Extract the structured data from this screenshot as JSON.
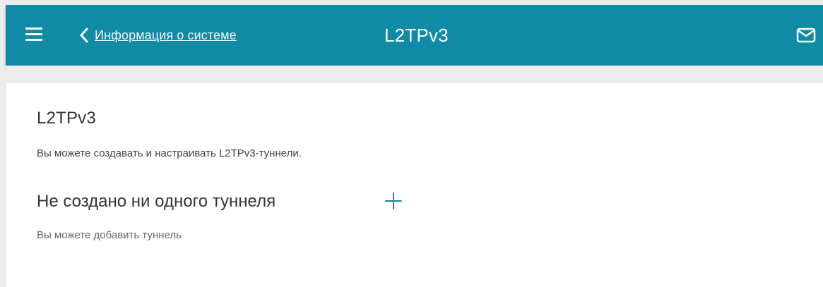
{
  "header": {
    "back_label": "Информация о системе",
    "title": "L2TPv3",
    "menu_icon": "hamburger-menu-icon",
    "back_icon": "chevron-left-icon",
    "mail_icon": "envelope-icon",
    "bar_color": "#118aa5"
  },
  "main": {
    "section_title": "L2TPv3",
    "section_description": "Вы можете создавать и настраивать L2TPv3-туннели.",
    "empty_title": "Не создано ни одного туннеля",
    "empty_description": "Вы можете добавить туннель",
    "add_icon": "plus-icon",
    "accent_color": "#118aa5"
  }
}
